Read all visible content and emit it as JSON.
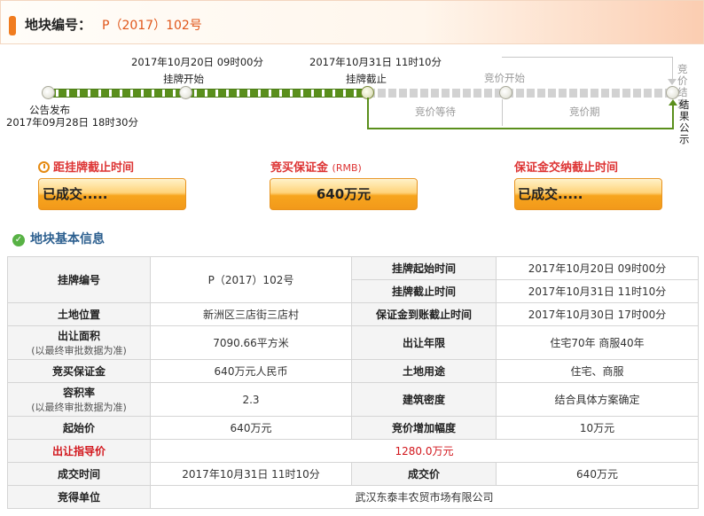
{
  "header": {
    "label": "地块编号：",
    "code": "P（2017）102号"
  },
  "timeline": {
    "announce_label": "公告发布",
    "announce_time": "2017年09月28日  18时30分",
    "listing_start_time": "2017年10月20日  09时00分",
    "listing_start_label": "挂牌开始",
    "listing_end_time": "2017年10月31日  11时10分",
    "listing_end_label": "挂牌截止",
    "bid_start_label": "竞价开始",
    "bid_wait_label": "竞价等待",
    "bid_period_label": "竞价期",
    "bid_end_label": "竞价结束",
    "result_label": "结果公示"
  },
  "countdowns": [
    {
      "title": "距挂牌截止时间",
      "value": "已成交....."
    },
    {
      "title": "竞买保证金",
      "subtitle": "(RMB)",
      "value": "640万元"
    },
    {
      "title": "保证金交纳截止时间",
      "value": "已成交....."
    }
  ],
  "section_title": "地块基本信息",
  "info": {
    "listing_no_label": "挂牌编号",
    "listing_no": "P（2017）102号",
    "start_time_label": "挂牌起始时间",
    "start_time": "2017年10月20日  09时00分",
    "end_time_label": "挂牌截止时间",
    "end_time": "2017年10月31日  11时10分",
    "location_label": "土地位置",
    "location": "新洲区三店街三店村",
    "deposit_deadline_label": "保证金到账截止时间",
    "deposit_deadline": "2017年10月30日  17时00分",
    "area_label": "出让面积",
    "area_note": "(以最终审批数据为准)",
    "area": "7090.66平方米",
    "term_label": "出让年限",
    "term": "住宅70年  商服40年",
    "deposit_label": "竞买保证金",
    "deposit": "640万元人民币",
    "use_label": "土地用途",
    "use": "住宅、商服",
    "far_label": "容积率",
    "far_note": "(以最终审批数据为准)",
    "far": "2.3",
    "density_label": "建筑密度",
    "density": "结合具体方案确定",
    "start_price_label": "起始价",
    "start_price": "640万元",
    "increment_label": "竞价增加幅度",
    "increment": "10万元",
    "guide_price_label": "出让指导价",
    "guide_price": "1280.0万元",
    "deal_time_label": "成交时间",
    "deal_time": "2017年10月31日  11时10分",
    "deal_price_label": "成交价",
    "deal_price": "640万元",
    "winner_label": "竞得单位",
    "winner": "武汉东泰丰农贸市场有限公司"
  }
}
